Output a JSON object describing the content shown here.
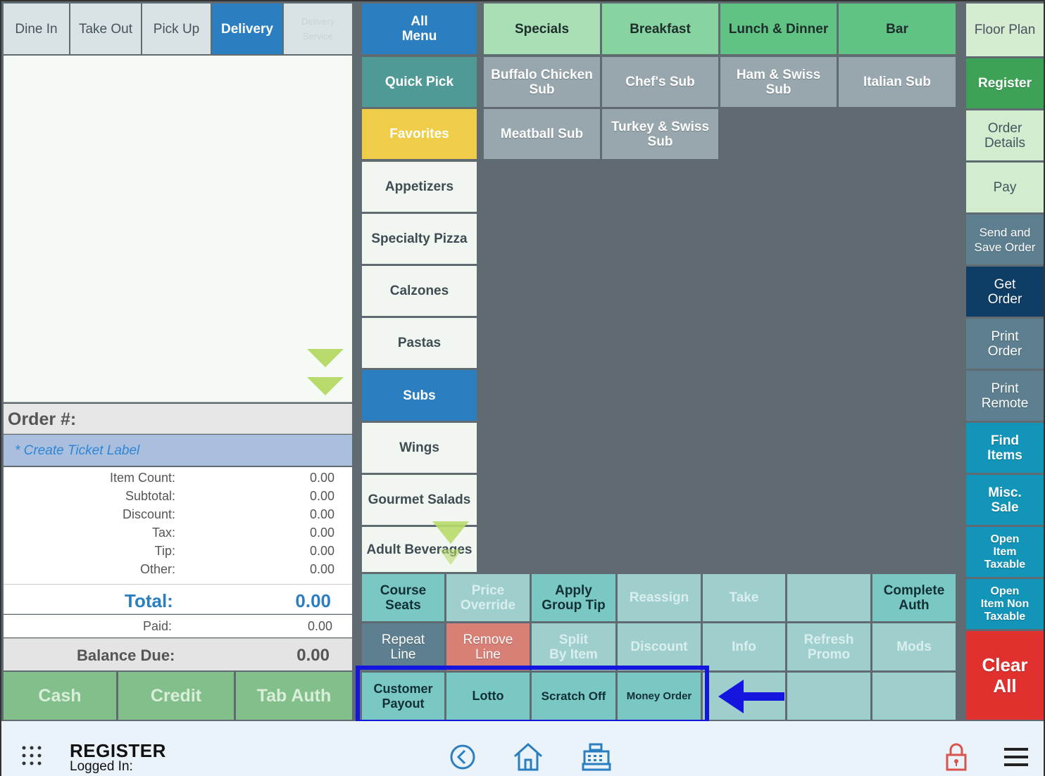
{
  "order_tabs": [
    {
      "label": "Dine In"
    },
    {
      "label": "Take Out"
    },
    {
      "label": "Pick Up"
    },
    {
      "label": "Delivery"
    },
    {
      "label": "Delivery\nService"
    }
  ],
  "categories_top": [
    {
      "label": "All\nMenu"
    },
    {
      "label": "Specials"
    },
    {
      "label": "Breakfast"
    },
    {
      "label": "Lunch & Dinner"
    },
    {
      "label": "Bar"
    }
  ],
  "categories_side": [
    {
      "label": "Quick Pick"
    },
    {
      "label": "Favorites"
    },
    {
      "label": "Appetizers"
    },
    {
      "label": "Specialty Pizza"
    },
    {
      "label": "Calzones"
    },
    {
      "label": "Pastas"
    },
    {
      "label": "Subs"
    },
    {
      "label": "Wings"
    },
    {
      "label": "Gourmet Salads"
    },
    {
      "label": "Adult Beverages"
    }
  ],
  "items": [
    {
      "label": "Buffalo Chicken\nSub"
    },
    {
      "label": "Chef's Sub"
    },
    {
      "label": "Ham & Swiss\nSub"
    },
    {
      "label": "Italian Sub"
    },
    {
      "label": "Meatball Sub"
    },
    {
      "label": "Turkey & Swiss\nSub"
    }
  ],
  "right_buttons": [
    {
      "label": "Floor Plan"
    },
    {
      "label": "Register"
    },
    {
      "label": "Order\nDetails"
    },
    {
      "label": "Pay"
    },
    {
      "label": "Send and\nSave Order"
    },
    {
      "label": "Get\nOrder"
    },
    {
      "label": "Print\nOrder"
    },
    {
      "label": "Print\nRemote"
    },
    {
      "label": "Find\nItems"
    },
    {
      "label": "Misc.\nSale"
    },
    {
      "label": "Open\nItem\nTaxable"
    },
    {
      "label": "Open\nItem Non\nTaxable"
    },
    {
      "label": "Clear\nAll"
    }
  ],
  "actions_row1": [
    {
      "label": "Course\nSeats"
    },
    {
      "label": "Price\nOverride"
    },
    {
      "label": "Apply\nGroup Tip"
    },
    {
      "label": "Reassign"
    },
    {
      "label": "Take"
    },
    {
      "label": ""
    },
    {
      "label": "Complete\nAuth"
    }
  ],
  "actions_row2": [
    {
      "label": "Repeat\nLine"
    },
    {
      "label": "Remove\nLine"
    },
    {
      "label": "Split\nBy Item"
    },
    {
      "label": "Discount"
    },
    {
      "label": "Info"
    },
    {
      "label": "Refresh\nPromo"
    },
    {
      "label": "Mods"
    }
  ],
  "actions_row3": [
    {
      "label": "Customer\nPayout"
    },
    {
      "label": "Lotto"
    },
    {
      "label": "Scratch Off"
    },
    {
      "label": "Money Order"
    }
  ],
  "order": {
    "number_label": "Order #:",
    "ticket_label": "* Create Ticket Label",
    "summary": [
      {
        "label": "Item Count:",
        "value": "0.00"
      },
      {
        "label": "Subtotal:",
        "value": "0.00"
      },
      {
        "label": "Discount:",
        "value": "0.00"
      },
      {
        "label": "Tax:",
        "value": "0.00"
      },
      {
        "label": "Tip:",
        "value": "0.00"
      },
      {
        "label": "Other:",
        "value": "0.00"
      }
    ],
    "total_label": "Total:",
    "total_value": "0.00",
    "paid_label": "Paid:",
    "paid_value": "0.00",
    "balance_label": "Balance Due:",
    "balance_value": "0.00"
  },
  "payment_buttons": [
    {
      "label": "Cash"
    },
    {
      "label": "Credit"
    },
    {
      "label": "Tab Auth"
    }
  ],
  "footer": {
    "title": "REGISTER",
    "subtitle": "Logged In:"
  },
  "colors": {
    "active_blue": "#2b7fc0",
    "highlight_box": "#1515e0",
    "clear_red": "#e0312f"
  }
}
